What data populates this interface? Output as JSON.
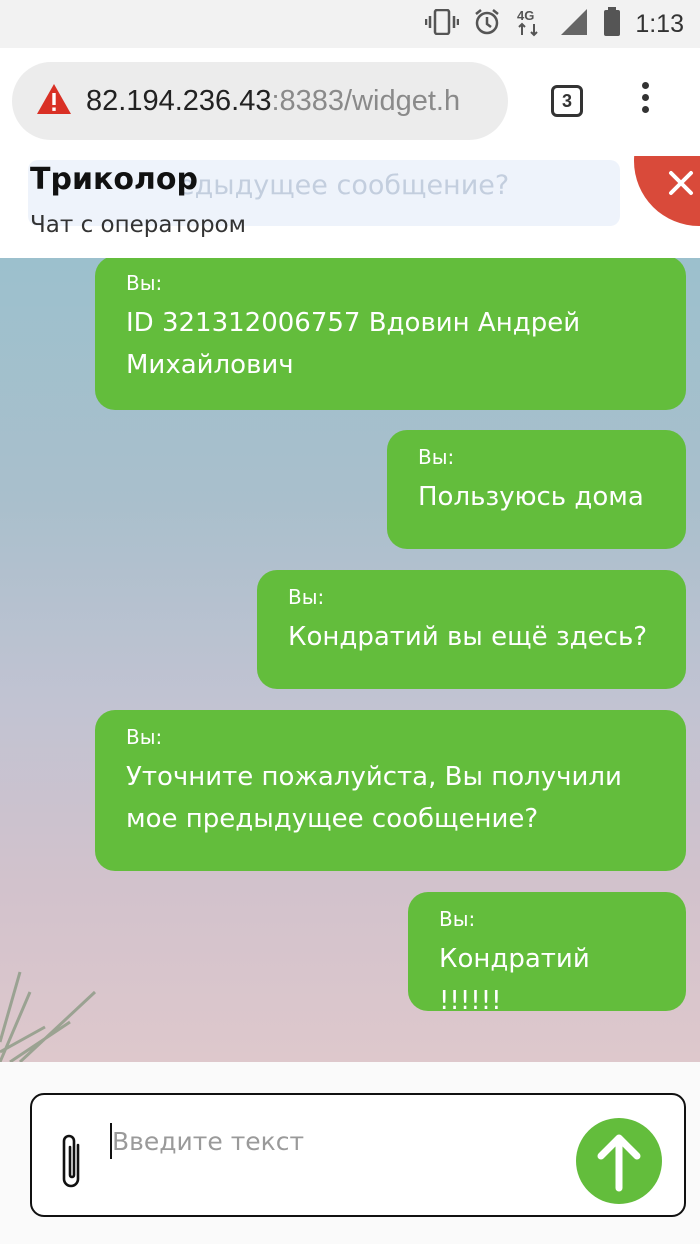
{
  "status_bar": {
    "time": "1:13",
    "network_type": "4G",
    "icons": [
      "vibrate-icon",
      "alarm-icon",
      "network-4g-icon",
      "signal-icon",
      "battery-icon"
    ]
  },
  "browser": {
    "url_host": "82.194.236.43",
    "url_rest": ":8383/widget.h",
    "security_icon": "warning-icon",
    "tab_count": "3"
  },
  "chat_header": {
    "title": "Триколор",
    "subtitle": "Чат с оператором",
    "ghost_text": "едыдущее сообщение?"
  },
  "messages": [
    {
      "sender": "Вы:",
      "text": "ID 321312006757 Вдовин Андрей Михайлович"
    },
    {
      "sender": "Вы:",
      "text": "Пользуюсь дома"
    },
    {
      "sender": "Вы:",
      "text": "Кондратий вы ещё здесь?"
    },
    {
      "sender": "Вы:",
      "text": "Уточните пожалуйста, Вы получили мое предыдущее сообщение?"
    },
    {
      "sender": "Вы:",
      "text": "Кондратий !!!!!!"
    }
  ],
  "composer": {
    "placeholder": "Введите текст",
    "value": "",
    "attach_icon": "paperclip-icon",
    "send_icon": "arrow-up-icon"
  },
  "colors": {
    "bubble": "#63bd3c",
    "close_button": "#d94a3a",
    "send_button": "#63bd3c",
    "warning": "#d93025"
  }
}
